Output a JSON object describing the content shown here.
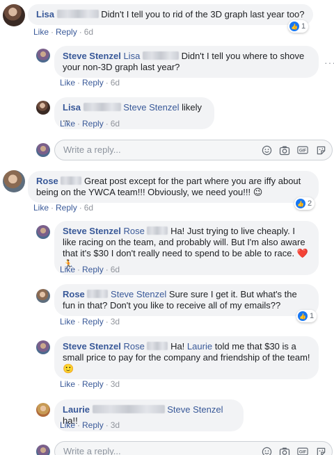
{
  "actions": {
    "like": "Like",
    "reply": "Reply",
    "dot": "·"
  },
  "comments": [
    {
      "author": "Lisa",
      "tag": "",
      "text": "Didn't I tell you to rid of the 3D graph last year too?",
      "time": "6d",
      "reactions": "1"
    },
    {
      "author": "Steve Stenzel",
      "tag": "Lisa",
      "text": "Didn't I tell you where to shove your non-3D graph last year?",
      "time": "6d"
    },
    {
      "author": "Lisa",
      "tag": "Steve Stenzel",
      "text": "likely ...",
      "time": "6d"
    },
    {
      "author": "Rose",
      "tag": "",
      "text": "Great post except for the part where you are iffy about being on the YWCA team!!! Obviously, we need you!!!",
      "emoji": "😉",
      "time": "6d",
      "reactions": "2"
    },
    {
      "author": "Steve Stenzel",
      "tag": "Rose",
      "text": "Ha! Just trying to live cheaply. I like racing on the team, and probably will. But I'm also aware that it's $30 I don't really need to spend to be able to race.",
      "emoji": "❤️ 🏃",
      "time": "6d"
    },
    {
      "author": "Rose",
      "tag": "Steve Stenzel",
      "text": "Sure sure I get it. But what's the fun in that? Don't you like to receive all of my emails??",
      "time": "3d",
      "reactions": "1"
    },
    {
      "author": "Steve Stenzel",
      "tag": "Rose",
      "text_before": "Ha!",
      "tag2": "Laurie",
      "text": "told me that $30 is a small price to pay for the company and friendship of the team!",
      "emoji": "🙂",
      "time": "3d"
    },
    {
      "author": "Laurie",
      "tag": "Steve Stenzel",
      "text": "ha!!",
      "time": "3d"
    }
  ],
  "reply_box": {
    "placeholder": "Write a reply..."
  },
  "more_options": "···",
  "icons": [
    "emoji-icon",
    "camera-icon",
    "gif-icon",
    "sticker-icon",
    "like-reaction-icon"
  ],
  "colors": {
    "link": "#385898",
    "bubble": "#f2f3f5",
    "meta": "#90949c",
    "like_blue": "#1877f2"
  }
}
